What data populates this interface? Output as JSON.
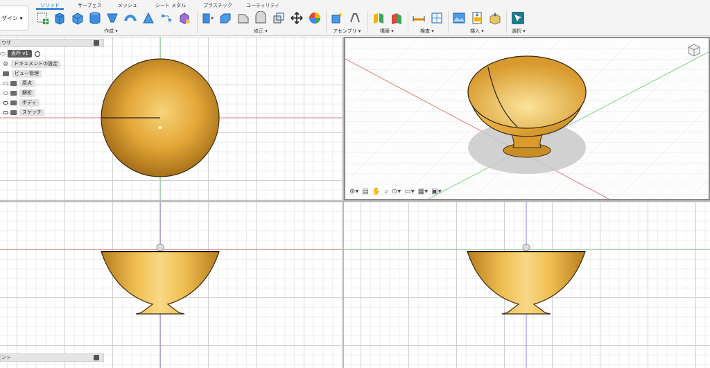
{
  "toolbar": {
    "workspace_label": "ザイン ▾",
    "tabs": [
      "ソリッド",
      "サーフェス",
      "メッシュ",
      "シート メタル",
      "プラスチック",
      "ユーティリティ"
    ],
    "groups": {
      "create": "作成 ▾",
      "modify": "修正 ▾",
      "assemble": "アセンブリ ▾",
      "construct": "構築 ▾",
      "inspect": "検査 ▾",
      "insert": "挿入 ▾",
      "select": "選択 ▾"
    }
  },
  "browser": {
    "header": "ウザ",
    "root": "盃杯 v1",
    "items": [
      "ドキュメントの設定",
      "ビュー管理",
      "原点",
      "解析",
      "ボディ",
      "スケッチ"
    ]
  },
  "comments": {
    "label": "ント"
  },
  "colors": {
    "body": "#e3a637",
    "accent": "#0a6ed1",
    "x_axis": "#e07a7a",
    "y_axis": "#7fd08a",
    "z_axis": "#8080e0"
  }
}
